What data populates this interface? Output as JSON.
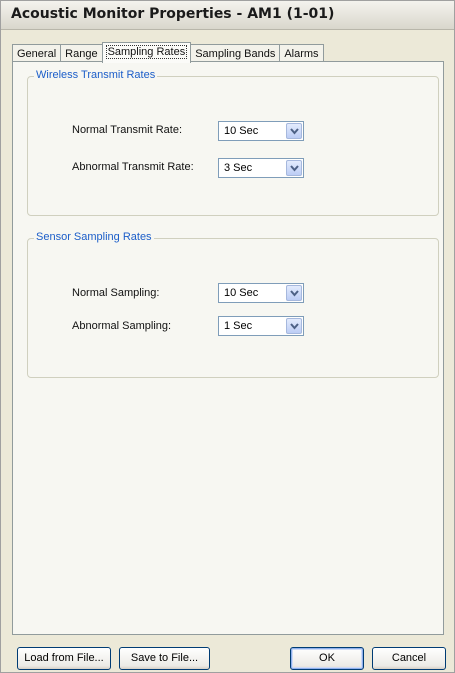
{
  "window": {
    "title": "Acoustic Monitor Properties - AM1 (1-01)"
  },
  "tabs": [
    {
      "label": "General",
      "selected": false
    },
    {
      "label": "Range",
      "selected": false
    },
    {
      "label": "Sampling Rates",
      "selected": true
    },
    {
      "label": "Sampling Bands",
      "selected": false
    },
    {
      "label": "Alarms",
      "selected": false
    }
  ],
  "wireless": {
    "title": "Wireless Transmit Rates",
    "normal_label": "Normal Transmit Rate:",
    "normal_value": "10 Sec",
    "abnormal_label": "Abnormal Transmit Rate:",
    "abnormal_value": "3 Sec"
  },
  "sensor": {
    "title": "Sensor Sampling Rates",
    "normal_label": "Normal Sampling:",
    "normal_value": "10 Sec",
    "abnormal_label": "Abnormal Sampling:",
    "abnormal_value": "1 Sec"
  },
  "buttons": {
    "load": "Load from File...",
    "save": "Save to File...",
    "ok": "OK",
    "cancel": "Cancel"
  },
  "colors": {
    "group_title": "#1c5ec9",
    "dialog_face": "#ece9d8",
    "panel_face": "#f7f7f2"
  },
  "icons": {
    "dropdown": "chevron-down-icon"
  }
}
